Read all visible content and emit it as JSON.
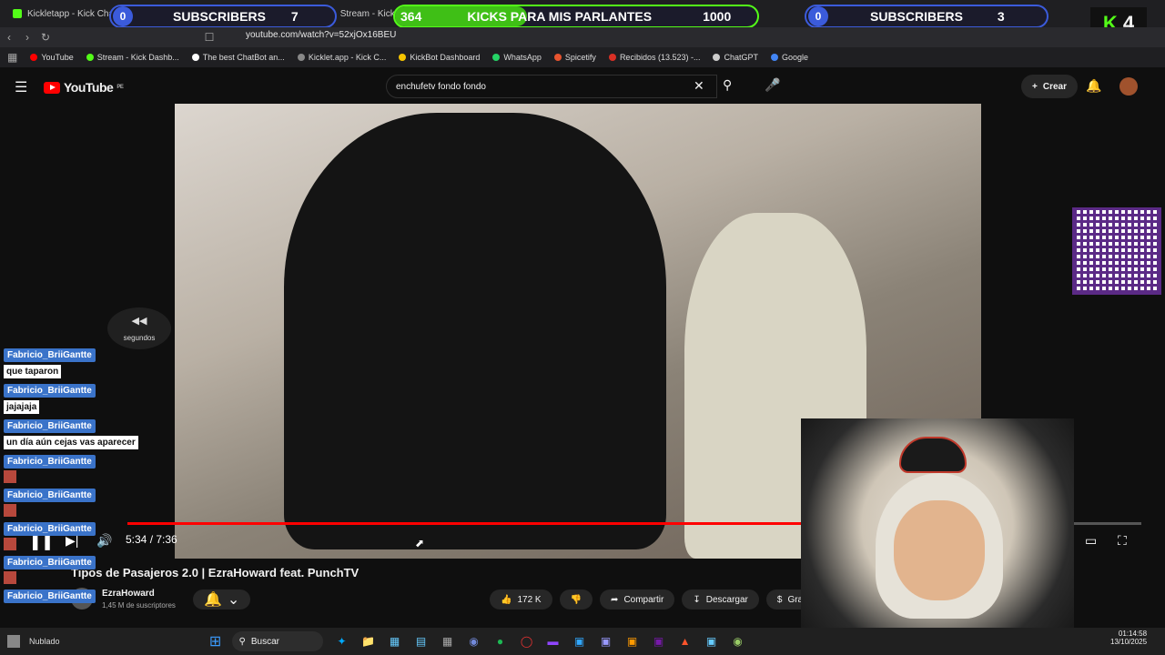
{
  "browser": {
    "tabs": [
      {
        "label": "Kickletapp - Kick Chatbot"
      },
      {
        "label": "Stream - Kick Dashbo"
      }
    ],
    "url": "youtube.com/watch?v=52xjOx16BEU",
    "bookmarks": [
      {
        "label": "YouTube",
        "color": "#ff0000"
      },
      {
        "label": "Stream - Kick Dashb...",
        "color": "#53fc18"
      },
      {
        "label": "The best ChatBot an...",
        "color": "#ffffff"
      },
      {
        "label": "Kicklet.app - Kick C...",
        "color": "#888888"
      },
      {
        "label": "KickBot Dashboard",
        "color": "#f5c400"
      },
      {
        "label": "WhatsApp",
        "color": "#25d366"
      },
      {
        "label": "Spicetify",
        "color": "#e8542f"
      },
      {
        "label": "Recibidos (13.523) -...",
        "color": "#d93025"
      },
      {
        "label": "ChatGPT",
        "color": "#cccccc"
      },
      {
        "label": "Google",
        "color": "#4285f4"
      }
    ]
  },
  "overlays": {
    "left_subs": {
      "count": "0",
      "label": "SUBSCRIBERS",
      "goal": "7"
    },
    "kicks": {
      "count": "364",
      "label": "KICKS PARA MIS PARLANTES",
      "goal": "1000"
    },
    "right_subs": {
      "count": "0",
      "label": "SUBSCRIBERS",
      "goal": "3"
    },
    "kick_badge": {
      "letter": "K",
      "num": "4"
    }
  },
  "youtube": {
    "logo": "YouTube",
    "region": "PE",
    "search_value": "enchufetv fondo fondo",
    "create_label": "Crear",
    "video": {
      "time": "5:34 / 7:36",
      "progress": 0.733,
      "title": "Tipos de Pasajeros 2.0 | EzraHoward feat. PunchTV",
      "channel": "EzraHoward",
      "subscribers": "1,45 M de suscriptores",
      "likes": "172 K",
      "share": "Compartir",
      "download": "Descargar",
      "thanks": "Gracias",
      "skip_hint": "segundos"
    }
  },
  "chat": [
    {
      "user": "Fabricio_BriiGantte",
      "msg": "que taparon"
    },
    {
      "user": "Fabricio_BriiGantte",
      "msg": "jajajaja"
    },
    {
      "user": "Fabricio_BriiGantte",
      "msg": "un día aún cejas vas aparecer"
    },
    {
      "user": "Fabricio_BriiGantte",
      "msg": ""
    },
    {
      "user": "Fabricio_BriiGantte",
      "msg": ""
    },
    {
      "user": "Fabricio_BriiGantte",
      "msg": ""
    },
    {
      "user": "Fabricio_BriiGantte",
      "msg": ""
    },
    {
      "user": "Fabricio_BriiGantte",
      "msg": ""
    },
    {
      "user": "Fabricio_BriiGantte",
      "msg": ""
    }
  ],
  "taskbar": {
    "search_label": "Buscar",
    "weather": "Nublado",
    "time": "01:14:58",
    "date": "13/10/2025"
  }
}
